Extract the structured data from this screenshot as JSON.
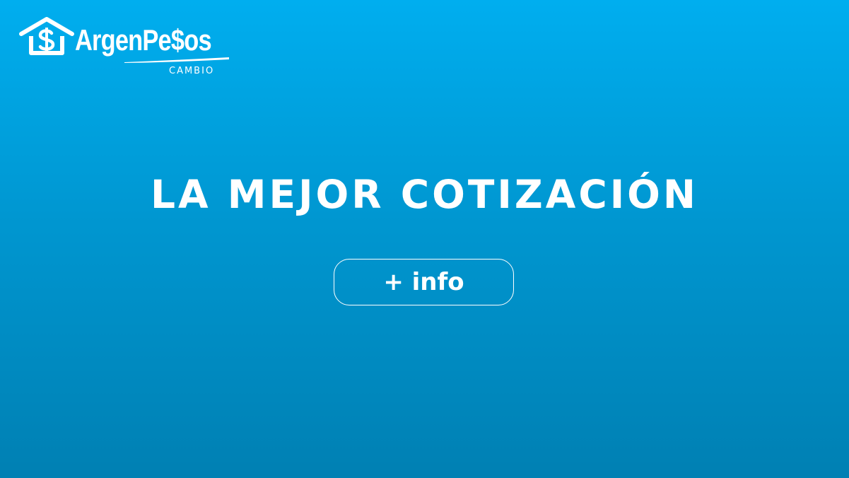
{
  "brand": {
    "name": "ArgenPe$os",
    "subtitle": "CAMBIO",
    "logo_icon": "house-dollar-icon"
  },
  "hero": {
    "headline": "LA MEJOR COTIZACIÓN",
    "cta_label": "+ info"
  },
  "colors": {
    "background_top": "#00aeef",
    "background_bottom": "#0080b3",
    "foreground": "#ffffff"
  }
}
